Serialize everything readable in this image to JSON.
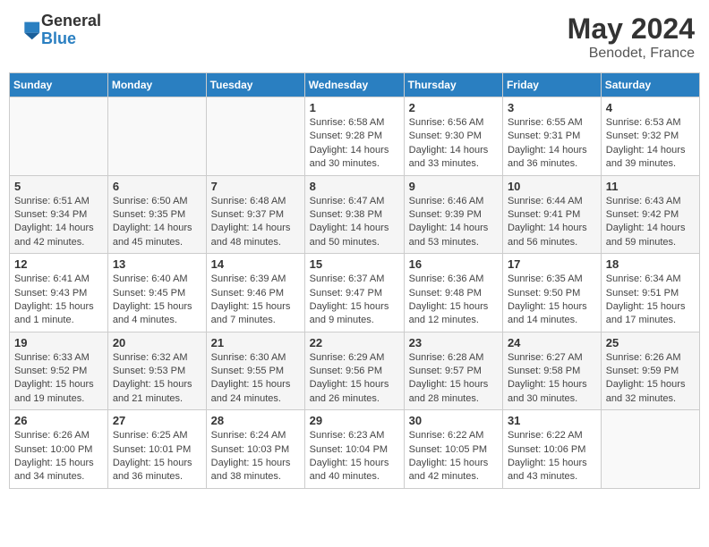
{
  "logo": {
    "general": "General",
    "blue": "Blue"
  },
  "title": {
    "month_year": "May 2024",
    "location": "Benodet, France"
  },
  "headers": [
    "Sunday",
    "Monday",
    "Tuesday",
    "Wednesday",
    "Thursday",
    "Friday",
    "Saturday"
  ],
  "weeks": [
    [
      {
        "day": "",
        "info": ""
      },
      {
        "day": "",
        "info": ""
      },
      {
        "day": "",
        "info": ""
      },
      {
        "day": "1",
        "info": "Sunrise: 6:58 AM\nSunset: 9:28 PM\nDaylight: 14 hours\nand 30 minutes."
      },
      {
        "day": "2",
        "info": "Sunrise: 6:56 AM\nSunset: 9:30 PM\nDaylight: 14 hours\nand 33 minutes."
      },
      {
        "day": "3",
        "info": "Sunrise: 6:55 AM\nSunset: 9:31 PM\nDaylight: 14 hours\nand 36 minutes."
      },
      {
        "day": "4",
        "info": "Sunrise: 6:53 AM\nSunset: 9:32 PM\nDaylight: 14 hours\nand 39 minutes."
      }
    ],
    [
      {
        "day": "5",
        "info": "Sunrise: 6:51 AM\nSunset: 9:34 PM\nDaylight: 14 hours\nand 42 minutes."
      },
      {
        "day": "6",
        "info": "Sunrise: 6:50 AM\nSunset: 9:35 PM\nDaylight: 14 hours\nand 45 minutes."
      },
      {
        "day": "7",
        "info": "Sunrise: 6:48 AM\nSunset: 9:37 PM\nDaylight: 14 hours\nand 48 minutes."
      },
      {
        "day": "8",
        "info": "Sunrise: 6:47 AM\nSunset: 9:38 PM\nDaylight: 14 hours\nand 50 minutes."
      },
      {
        "day": "9",
        "info": "Sunrise: 6:46 AM\nSunset: 9:39 PM\nDaylight: 14 hours\nand 53 minutes."
      },
      {
        "day": "10",
        "info": "Sunrise: 6:44 AM\nSunset: 9:41 PM\nDaylight: 14 hours\nand 56 minutes."
      },
      {
        "day": "11",
        "info": "Sunrise: 6:43 AM\nSunset: 9:42 PM\nDaylight: 14 hours\nand 59 minutes."
      }
    ],
    [
      {
        "day": "12",
        "info": "Sunrise: 6:41 AM\nSunset: 9:43 PM\nDaylight: 15 hours\nand 1 minute."
      },
      {
        "day": "13",
        "info": "Sunrise: 6:40 AM\nSunset: 9:45 PM\nDaylight: 15 hours\nand 4 minutes."
      },
      {
        "day": "14",
        "info": "Sunrise: 6:39 AM\nSunset: 9:46 PM\nDaylight: 15 hours\nand 7 minutes."
      },
      {
        "day": "15",
        "info": "Sunrise: 6:37 AM\nSunset: 9:47 PM\nDaylight: 15 hours\nand 9 minutes."
      },
      {
        "day": "16",
        "info": "Sunrise: 6:36 AM\nSunset: 9:48 PM\nDaylight: 15 hours\nand 12 minutes."
      },
      {
        "day": "17",
        "info": "Sunrise: 6:35 AM\nSunset: 9:50 PM\nDaylight: 15 hours\nand 14 minutes."
      },
      {
        "day": "18",
        "info": "Sunrise: 6:34 AM\nSunset: 9:51 PM\nDaylight: 15 hours\nand 17 minutes."
      }
    ],
    [
      {
        "day": "19",
        "info": "Sunrise: 6:33 AM\nSunset: 9:52 PM\nDaylight: 15 hours\nand 19 minutes."
      },
      {
        "day": "20",
        "info": "Sunrise: 6:32 AM\nSunset: 9:53 PM\nDaylight: 15 hours\nand 21 minutes."
      },
      {
        "day": "21",
        "info": "Sunrise: 6:30 AM\nSunset: 9:55 PM\nDaylight: 15 hours\nand 24 minutes."
      },
      {
        "day": "22",
        "info": "Sunrise: 6:29 AM\nSunset: 9:56 PM\nDaylight: 15 hours\nand 26 minutes."
      },
      {
        "day": "23",
        "info": "Sunrise: 6:28 AM\nSunset: 9:57 PM\nDaylight: 15 hours\nand 28 minutes."
      },
      {
        "day": "24",
        "info": "Sunrise: 6:27 AM\nSunset: 9:58 PM\nDaylight: 15 hours\nand 30 minutes."
      },
      {
        "day": "25",
        "info": "Sunrise: 6:26 AM\nSunset: 9:59 PM\nDaylight: 15 hours\nand 32 minutes."
      }
    ],
    [
      {
        "day": "26",
        "info": "Sunrise: 6:26 AM\nSunset: 10:00 PM\nDaylight: 15 hours\nand 34 minutes."
      },
      {
        "day": "27",
        "info": "Sunrise: 6:25 AM\nSunset: 10:01 PM\nDaylight: 15 hours\nand 36 minutes."
      },
      {
        "day": "28",
        "info": "Sunrise: 6:24 AM\nSunset: 10:03 PM\nDaylight: 15 hours\nand 38 minutes."
      },
      {
        "day": "29",
        "info": "Sunrise: 6:23 AM\nSunset: 10:04 PM\nDaylight: 15 hours\nand 40 minutes."
      },
      {
        "day": "30",
        "info": "Sunrise: 6:22 AM\nSunset: 10:05 PM\nDaylight: 15 hours\nand 42 minutes."
      },
      {
        "day": "31",
        "info": "Sunrise: 6:22 AM\nSunset: 10:06 PM\nDaylight: 15 hours\nand 43 minutes."
      },
      {
        "day": "",
        "info": ""
      }
    ]
  ]
}
